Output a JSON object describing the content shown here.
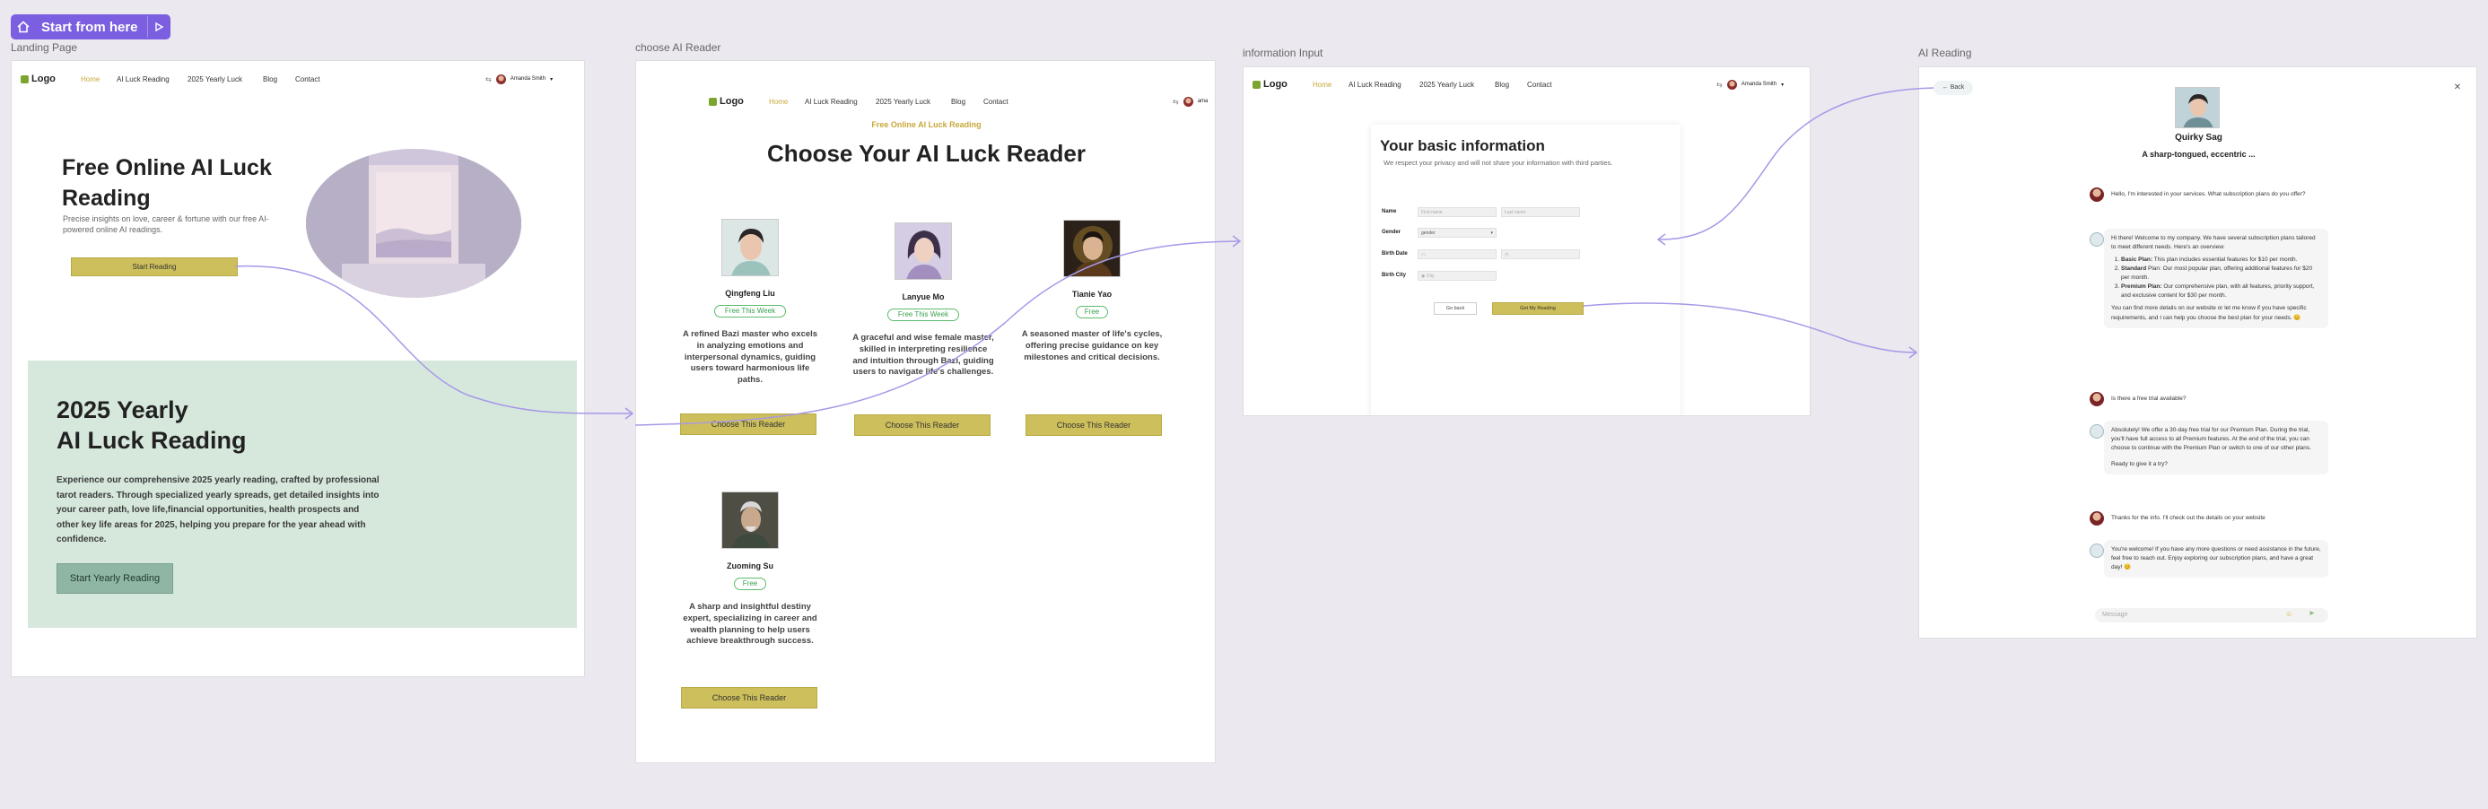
{
  "start_pill": {
    "label": "Start from here"
  },
  "frames": {
    "landing": "Landing Page",
    "choose": "choose AI Reader",
    "info": "information Input",
    "reading": "AI Reading"
  },
  "nav": {
    "logo": "Logo",
    "items": [
      "Home",
      "AI Luck Reading",
      "2025 Yearly Luck",
      "Blog",
      "Contact"
    ],
    "user": "Amanda Smith",
    "user_short": "ama"
  },
  "landing": {
    "hero_title": "Free Online AI Luck Reading",
    "hero_sub": "Precise insights on love, career & fortune with our free AI-powered online AI readings.",
    "hero_button": "Start Reading",
    "yearly_title_1": "2025  Yearly",
    "yearly_title_2": "AI Luck Reading",
    "yearly_body": "Experience our comprehensive 2025  yearly reading, crafted by professional tarot readers. Through specialized yearly spreads, get detailed insights into your career path, love life,financial opportunities, health prospects and other key life areas for 2025, helping you prepare for the year ahead with confidence.",
    "yearly_button": "Start Yearly Reading"
  },
  "choose": {
    "eyebrow": "Free Online AI Luck Reading",
    "title": "Choose Your AI Luck Reader",
    "button": "Choose This Reader",
    "readers": [
      {
        "name": "Qingfeng Liu",
        "tag": "Free This Week",
        "desc": "A refined Bazi master who excels in analyzing emotions and interpersonal dynamics, guiding users toward harmonious life paths."
      },
      {
        "name": "Lanyue Mo",
        "tag": "Free This Week",
        "desc": "A graceful and wise female master, skilled in interpreting resilience and intuition through Bazi, guiding users to navigate life's challenges."
      },
      {
        "name": "Tianie Yao",
        "tag": "Free",
        "desc": "A seasoned master of life's cycles, offering precise guidance on key milestones and critical decisions."
      },
      {
        "name": "Zuoming Su",
        "tag": "Free",
        "desc": "A sharp and insightful destiny expert, specializing in career and wealth planning to help users achieve breakthrough success."
      }
    ]
  },
  "info": {
    "title": "Your basic information",
    "subtitle": "We respect your privacy and will not share your information with third parties.",
    "labels": [
      "Name",
      "Gender",
      "Birth Date",
      "Birth City"
    ],
    "first_name": "First name",
    "last_name": "Last name",
    "gender": "gender",
    "city": "City",
    "back": "Go back",
    "submit": "Get My Reading"
  },
  "reading": {
    "back": "Back",
    "bot_name": "Quirky Sag",
    "bot_tagline": "A sharp-tongued, eccentric ...",
    "m1": "Hello, I'm interested in your services. What subscription plans do you offer?",
    "m2_intro": "Hi there! Welcome to my company. We have several subscription plans tailored to meet different needs. Here's an overview:",
    "m2_plans": [
      {
        "name": "Basic Plan:",
        "text": " This plan includes essential features for $10 per month."
      },
      {
        "name": "Standard",
        "text": " Plan: Our most popular plan, offering additional features for $20 per month."
      },
      {
        "name": "Premium Plan:",
        "text": " Our comprehensive plan, with all features, priority support, and exclusive content for $30 per month."
      }
    ],
    "m2_outro": "You can find more details on our website or let me know if you have specific requirements, and I can help you choose the best plan for your needs. 😊",
    "m3": "Is there a free trial available?",
    "m4a": "Absolutely! We offer a 30-day free trial for our Premium Plan. During the trial, you'll have full access to all Premium features. At the end of the trial, you can choose to continue with the Premium Plan or switch to one of our other plans.",
    "m4b": "Ready to give it a try?",
    "m5": "Thanks for the info. I'll check out the details on your website",
    "m6": "You're welcome! If you have any more questions or need assistance in the future, feel free to reach out. Enjoy exploring our subscription plans, and have a great day! 😊",
    "placeholder": "Message"
  },
  "colors": {
    "accent": "#7b5fe0",
    "gold": "#cdbf5b",
    "green_section": "#d6e8dc",
    "connector": "#a898e8"
  }
}
